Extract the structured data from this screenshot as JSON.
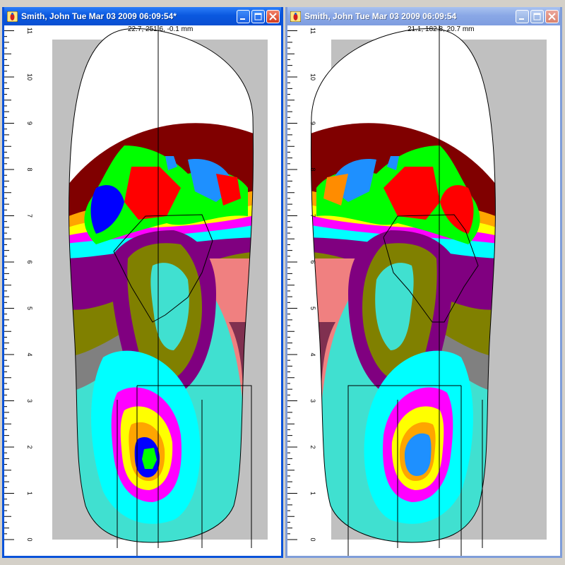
{
  "windows": [
    {
      "title": "Smith, John  Tue Mar 03 2009 06:09:54*",
      "readout": "22.7, 251.6, -0.1 mm",
      "ruler_labels": [
        "0",
        "1",
        "2",
        "3",
        "4",
        "5",
        "6",
        "7",
        "8",
        "9",
        "10",
        "11"
      ]
    },
    {
      "title": "Smith, John  Tue Mar 03 2009 06:09:54",
      "readout": "21.1, 182.8, 20.7 mm",
      "ruler_labels": [
        "0",
        "1",
        "2",
        "3",
        "4",
        "5",
        "6",
        "7",
        "8",
        "9",
        "10",
        "11"
      ]
    }
  ],
  "icons": {
    "app": "foot-scan-app-icon",
    "minimize": "minimize-icon",
    "maximize": "maximize-icon",
    "close": "close-icon"
  },
  "colors": {
    "active_title": "#0a58e0",
    "inactive_title": "#8aa8e6",
    "plot_background": "#c0c0c0",
    "contours": [
      "#800000",
      "#ff0000",
      "#0000ff",
      "#1e90ff",
      "#00ff00",
      "#ffa500",
      "#ffff00",
      "#ff00ff",
      "#00ffff",
      "#800080",
      "#808000",
      "#808080",
      "#40e0d0",
      "#008080",
      "#f08080",
      "#803050"
    ]
  }
}
